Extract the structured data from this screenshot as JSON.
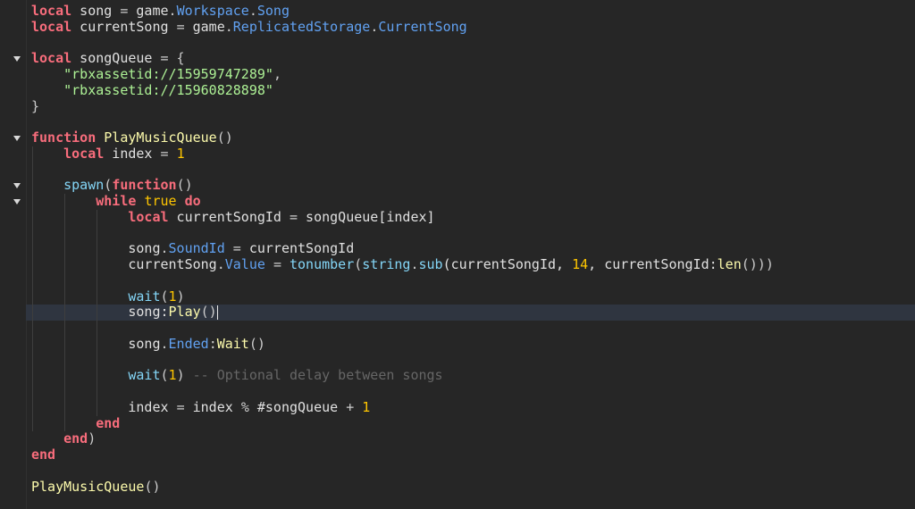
{
  "editor": {
    "lines": [
      [
        {
          "t": "local",
          "c": "kw"
        },
        {
          "t": " song ",
          "c": "id"
        },
        {
          "t": "=",
          "c": "op"
        },
        {
          "t": " game",
          "c": "id"
        },
        {
          "t": ".",
          "c": "op"
        },
        {
          "t": "Workspace",
          "c": "prop"
        },
        {
          "t": ".",
          "c": "op"
        },
        {
          "t": "Song",
          "c": "prop"
        }
      ],
      [
        {
          "t": "local",
          "c": "kw"
        },
        {
          "t": " currentSong ",
          "c": "id"
        },
        {
          "t": "=",
          "c": "op"
        },
        {
          "t": " game",
          "c": "id"
        },
        {
          "t": ".",
          "c": "op"
        },
        {
          "t": "ReplicatedStorage",
          "c": "prop"
        },
        {
          "t": ".",
          "c": "op"
        },
        {
          "t": "CurrentSong",
          "c": "prop"
        }
      ],
      [],
      [
        {
          "t": "local",
          "c": "kw"
        },
        {
          "t": " songQueue ",
          "c": "id"
        },
        {
          "t": "=",
          "c": "op"
        },
        {
          "t": " {",
          "c": "op"
        }
      ],
      [
        {
          "t": "    ",
          "c": "id"
        },
        {
          "t": "\"rbxassetid://15959747289\"",
          "c": "str"
        },
        {
          "t": ",",
          "c": "op"
        }
      ],
      [
        {
          "t": "    ",
          "c": "id"
        },
        {
          "t": "\"rbxassetid://15960828898\"",
          "c": "str"
        }
      ],
      [
        {
          "t": "}",
          "c": "op"
        }
      ],
      [],
      [
        {
          "t": "function",
          "c": "kw"
        },
        {
          "t": " ",
          "c": "id"
        },
        {
          "t": "PlayMusicQueue",
          "c": "fn"
        },
        {
          "t": "()",
          "c": "op"
        }
      ],
      [
        {
          "t": "    ",
          "c": "id"
        },
        {
          "t": "local",
          "c": "kw"
        },
        {
          "t": " index ",
          "c": "id"
        },
        {
          "t": "=",
          "c": "op"
        },
        {
          "t": " ",
          "c": "id"
        },
        {
          "t": "1",
          "c": "num"
        }
      ],
      [],
      [
        {
          "t": "    ",
          "c": "id"
        },
        {
          "t": "spawn",
          "c": "bi"
        },
        {
          "t": "(",
          "c": "op"
        },
        {
          "t": "function",
          "c": "kw"
        },
        {
          "t": "()",
          "c": "op"
        }
      ],
      [
        {
          "t": "        ",
          "c": "id"
        },
        {
          "t": "while",
          "c": "kw"
        },
        {
          "t": " ",
          "c": "id"
        },
        {
          "t": "true",
          "c": "num"
        },
        {
          "t": " ",
          "c": "id"
        },
        {
          "t": "do",
          "c": "kw"
        }
      ],
      [
        {
          "t": "            ",
          "c": "id"
        },
        {
          "t": "local",
          "c": "kw"
        },
        {
          "t": " currentSongId ",
          "c": "id"
        },
        {
          "t": "=",
          "c": "op"
        },
        {
          "t": " songQueue[index]",
          "c": "id"
        }
      ],
      [],
      [
        {
          "t": "            song",
          "c": "id"
        },
        {
          "t": ".",
          "c": "op"
        },
        {
          "t": "SoundId",
          "c": "prop"
        },
        {
          "t": " ",
          "c": "id"
        },
        {
          "t": "=",
          "c": "op"
        },
        {
          "t": " currentSongId",
          "c": "id"
        }
      ],
      [
        {
          "t": "            currentSong",
          "c": "id"
        },
        {
          "t": ".",
          "c": "op"
        },
        {
          "t": "Value",
          "c": "prop"
        },
        {
          "t": " ",
          "c": "id"
        },
        {
          "t": "=",
          "c": "op"
        },
        {
          "t": " ",
          "c": "id"
        },
        {
          "t": "tonumber",
          "c": "bi"
        },
        {
          "t": "(",
          "c": "op"
        },
        {
          "t": "string",
          "c": "bi"
        },
        {
          "t": ".",
          "c": "op"
        },
        {
          "t": "sub",
          "c": "bi"
        },
        {
          "t": "(currentSongId, ",
          "c": "id"
        },
        {
          "t": "14",
          "c": "num"
        },
        {
          "t": ", currentSongId:",
          "c": "id"
        },
        {
          "t": "len",
          "c": "fn"
        },
        {
          "t": "()))",
          "c": "op"
        }
      ],
      [],
      [
        {
          "t": "            ",
          "c": "id"
        },
        {
          "t": "wait",
          "c": "bi"
        },
        {
          "t": "(",
          "c": "op"
        },
        {
          "t": "1",
          "c": "num"
        },
        {
          "t": ")",
          "c": "op"
        }
      ],
      [
        {
          "t": "            song:",
          "c": "id"
        },
        {
          "t": "Play",
          "c": "fn"
        },
        {
          "t": "()",
          "c": "op"
        }
      ],
      [],
      [
        {
          "t": "            song",
          "c": "id"
        },
        {
          "t": ".",
          "c": "op"
        },
        {
          "t": "Ended",
          "c": "prop"
        },
        {
          "t": ":",
          "c": "op"
        },
        {
          "t": "Wait",
          "c": "fn"
        },
        {
          "t": "()",
          "c": "op"
        }
      ],
      [],
      [
        {
          "t": "            ",
          "c": "id"
        },
        {
          "t": "wait",
          "c": "bi"
        },
        {
          "t": "(",
          "c": "op"
        },
        {
          "t": "1",
          "c": "num"
        },
        {
          "t": ") ",
          "c": "op"
        },
        {
          "t": "-- Optional delay between songs",
          "c": "cmt"
        }
      ],
      [],
      [
        {
          "t": "            index ",
          "c": "id"
        },
        {
          "t": "=",
          "c": "op"
        },
        {
          "t": " index ",
          "c": "id"
        },
        {
          "t": "%",
          "c": "op"
        },
        {
          "t": " #songQueue ",
          "c": "id"
        },
        {
          "t": "+",
          "c": "op"
        },
        {
          "t": " ",
          "c": "id"
        },
        {
          "t": "1",
          "c": "num"
        }
      ],
      [
        {
          "t": "        ",
          "c": "id"
        },
        {
          "t": "end",
          "c": "kw"
        }
      ],
      [
        {
          "t": "    ",
          "c": "id"
        },
        {
          "t": "end",
          "c": "kw"
        },
        {
          "t": ")",
          "c": "op"
        }
      ],
      [
        {
          "t": "end",
          "c": "kw"
        }
      ],
      [],
      [
        {
          "t": "PlayMusicQueue",
          "c": "fn"
        },
        {
          "t": "()",
          "c": "op"
        }
      ]
    ],
    "fold_lines": [
      3,
      8,
      11,
      12
    ],
    "current_line": 19
  },
  "colors": {
    "background": "#262626",
    "keyword": "#f86d7c",
    "property": "#61a1f1",
    "string": "#adf195",
    "number": "#ffc600",
    "function": "#fdfbac",
    "builtin": "#84d6f7",
    "comment": "#666666"
  }
}
